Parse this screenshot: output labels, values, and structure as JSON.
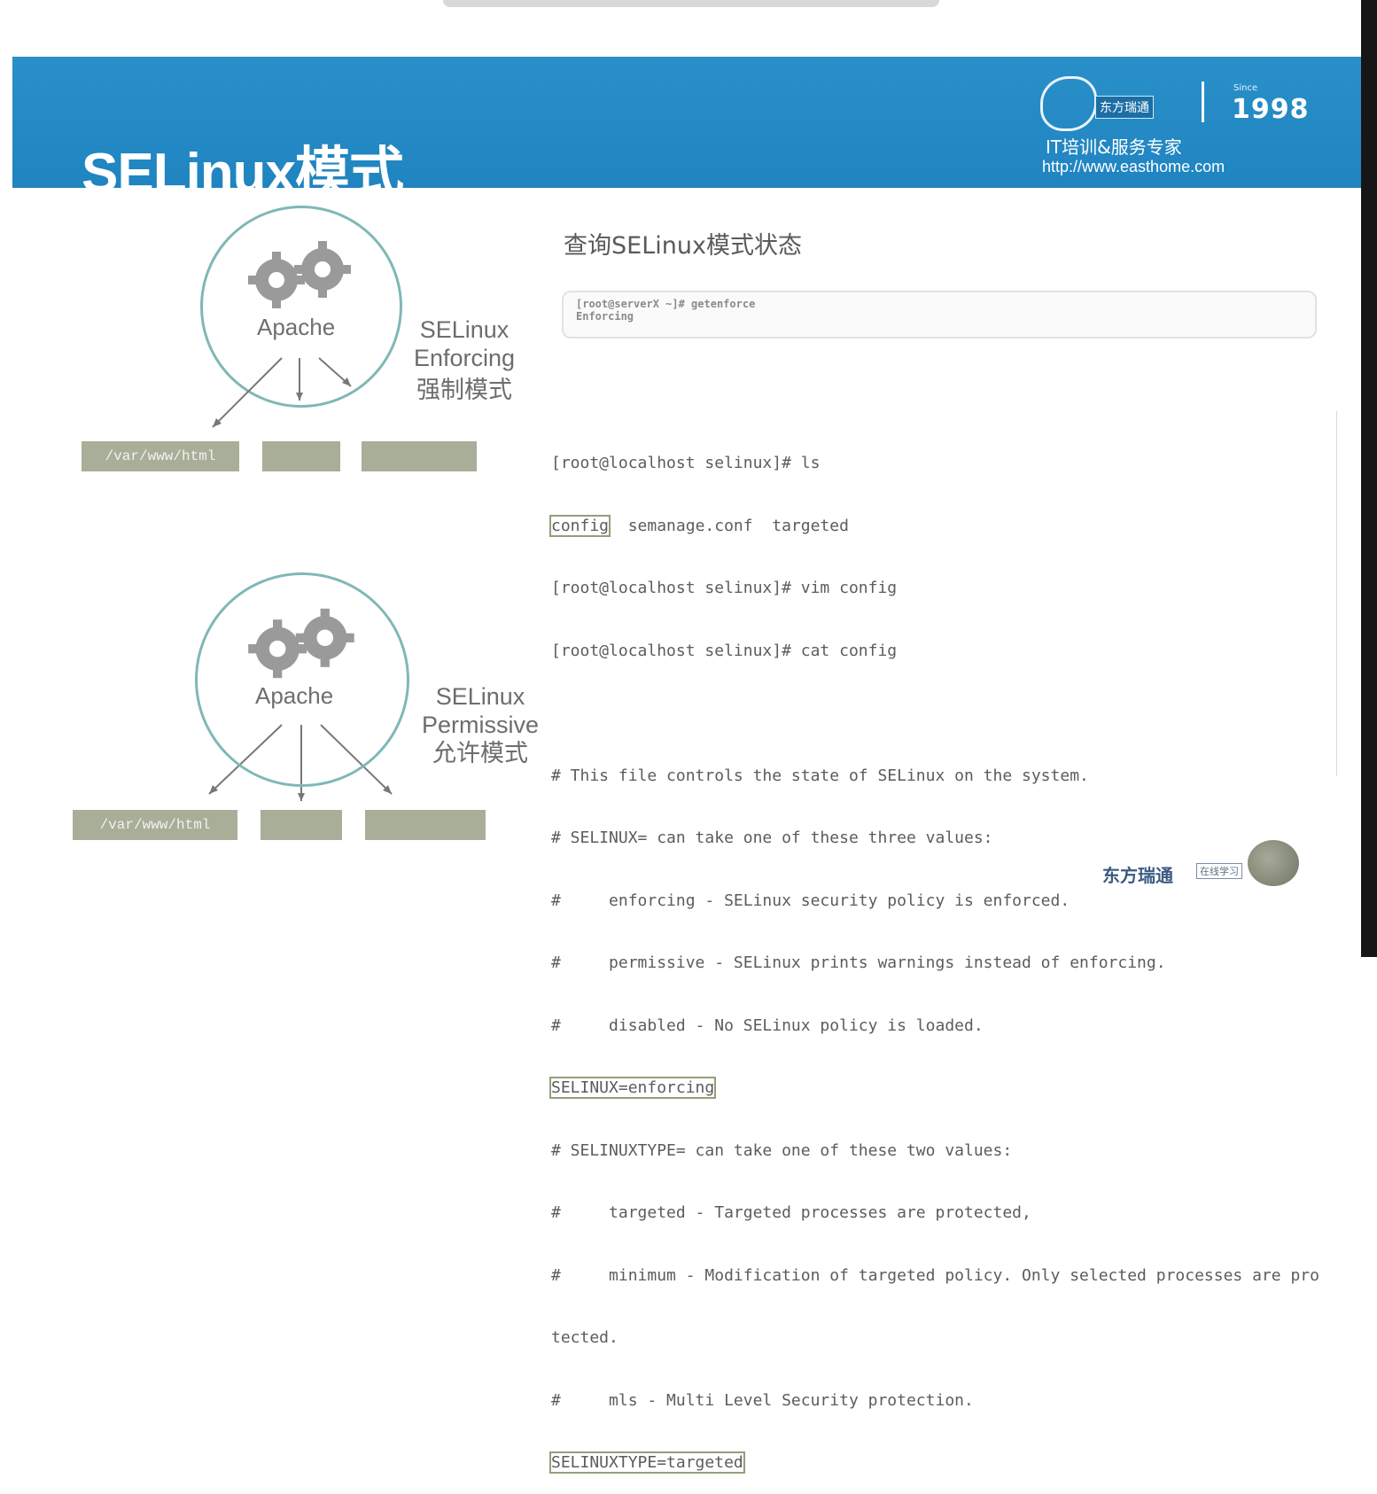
{
  "header": {
    "title": "SELinux模式",
    "brand_name": "东方瑞通",
    "since_label": "Since",
    "year": "1998",
    "tagline": "IT培训&服务专家",
    "url": "http://www.easthome.com"
  },
  "diagram_top": {
    "app_label": "Apache",
    "mode_line1": "SELinux",
    "mode_line2": "Enforcing",
    "mode_line3": "强制模式",
    "targets": [
      "/var/www/html",
      "",
      ""
    ]
  },
  "diagram_bottom": {
    "app_label": "Apache",
    "mode_line1": "SELinux",
    "mode_line2": "Permissive",
    "mode_line3": "允许模式",
    "targets": [
      "/var/www/html",
      "",
      ""
    ]
  },
  "query": {
    "title": "查询SELinux模式状态",
    "cmd_line": "[root@serverX ~]# getenforce",
    "output_line": "Enforcing"
  },
  "terminal": {
    "lines": [
      "[root@localhost selinux]# ls",
      "config  semanage.conf  targeted",
      "[root@localhost selinux]# vim config",
      "[root@localhost selinux]# cat config",
      "",
      "# This file controls the state of SELinux on the system.",
      "# SELINUX= can take one of these three values:",
      "#     enforcing - SELinux security policy is enforced.",
      "#     permissive - SELinux prints warnings instead of enforcing.",
      "#     disabled - No SELinux policy is loaded.",
      "SELINUX=enforcing",
      "# SELINUXTYPE= can take one of these two values:",
      "#     targeted - Targeted processes are protected,",
      "#     minimum - Modification of targeted policy. Only selected processes are pro",
      "tected.",
      "#     mls - Multi Level Security protection.",
      "SELINUXTYPE=targeted"
    ]
  },
  "footer": {
    "brand": "东方瑞通",
    "sub": "在线学习"
  }
}
